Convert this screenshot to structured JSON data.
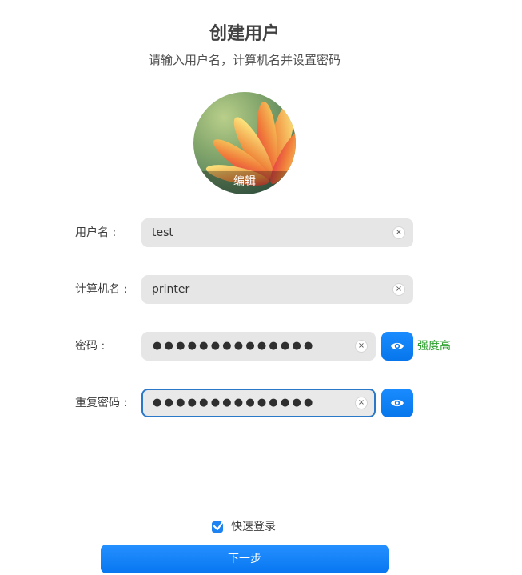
{
  "header": {
    "title": "创建用户",
    "subtitle": "请输入用户名，计算机名并设置密码"
  },
  "avatar": {
    "edit_label": "编辑"
  },
  "form": {
    "username": {
      "label": "用户名 :",
      "value": "test"
    },
    "hostname": {
      "label": "计算机名 :",
      "value": "printer"
    },
    "password": {
      "label": "密码 :",
      "value": "●●●●●●●●●●●●●●",
      "strength": "强度高"
    },
    "repeat_password": {
      "label": "重复密码 :",
      "value": "●●●●●●●●●●●●●●"
    },
    "clear_glyph": "×"
  },
  "footer": {
    "quick_login_label": "快速登录",
    "quick_login_checked": true,
    "next_label": "下一步"
  },
  "colors": {
    "accent": "#0a84ff",
    "strength_text": "#2aa02a",
    "focus_border": "#2b78c9"
  }
}
